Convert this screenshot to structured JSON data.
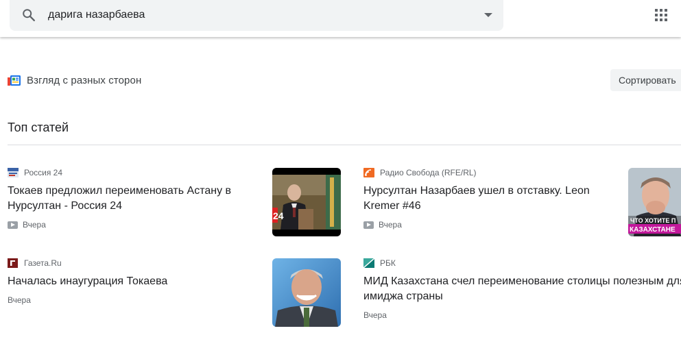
{
  "search": {
    "query": "дарига назарбаева",
    "search_icon": "search-icon",
    "dropdown_icon": "caret-down-icon"
  },
  "header": {
    "apps_icon": "apps-grid-icon"
  },
  "perspectives": {
    "label": "Взгляд с разных сторон",
    "icon": "newspaper-icon",
    "sort_label": "Сортировать"
  },
  "section": {
    "title": "Топ статей"
  },
  "articles": [
    {
      "source": "Россия 24",
      "headline": "Токаев предложил переименовать Астану в Нурсултан - Россия 24",
      "time": "Вчера",
      "video": true
    },
    {
      "source": "Радио Свобода (RFE/RL)",
      "headline": "Нурсултан Назарбаев ушел в отставку. Leon Kremer #46",
      "time": "Вчера",
      "video": true,
      "thumb_text_1": "ЧТО ХОТИТЕ П",
      "thumb_text_2": "КАЗАХСТАНЕ"
    },
    {
      "source": "Газета.Ru",
      "headline": "Началась инаугурация Токаева",
      "time": "Вчера",
      "video": false
    },
    {
      "source": "РБК",
      "headline": "МИД Казахстана счел переименование столицы полезным для имиджа страны",
      "time": "Вчера",
      "video": false
    }
  ],
  "colors": {
    "search_bg": "#f1f3f4",
    "text_primary": "#202124",
    "text_secondary": "#5f6368",
    "divider": "#dadce0"
  }
}
